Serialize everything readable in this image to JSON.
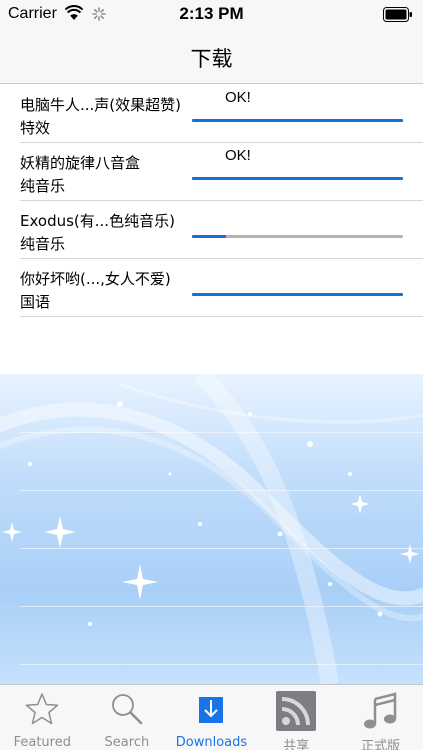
{
  "status_bar": {
    "carrier": "Carrier",
    "time": "2:13 PM"
  },
  "nav": {
    "title": "下载"
  },
  "downloads": [
    {
      "title": "电脑牛人...声(效果超赞)",
      "subtitle": "特效",
      "status": "OK!",
      "progress": 1.0
    },
    {
      "title": "妖精的旋律八音盒",
      "subtitle": "纯音乐",
      "status": "OK!",
      "progress": 1.0
    },
    {
      "title": "Exodus(有...色纯音乐)",
      "subtitle": "纯音乐",
      "status": "",
      "progress": 0.16
    },
    {
      "title": "你好坏哟(...,女人不爱)",
      "subtitle": "国语",
      "status": "",
      "progress": 1.0
    }
  ],
  "tabs": [
    {
      "label": "Featured",
      "icon": "star-icon"
    },
    {
      "label": "Search",
      "icon": "search-icon"
    },
    {
      "label": "Downloads",
      "icon": "download-icon",
      "active": true
    },
    {
      "label": "共享",
      "icon": "rss-icon"
    },
    {
      "label": "正式版",
      "icon": "music-note-icon"
    }
  ],
  "colors": {
    "accent": "#1a73e8",
    "progress_fill": "#1a6fd6",
    "progress_track": "#b4b4b4"
  }
}
